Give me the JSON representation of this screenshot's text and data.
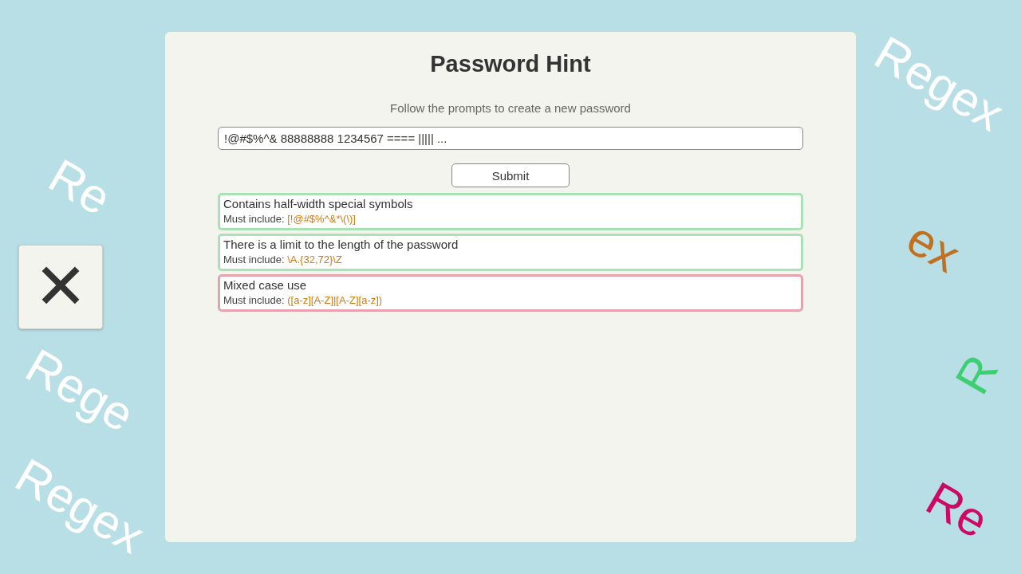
{
  "background_words": [
    {
      "text": "Regex",
      "color": "#ffffff"
    },
    {
      "text": "Re",
      "color": "#ffffff"
    },
    {
      "text": "Rege",
      "color": "#ffffff"
    },
    {
      "text": "Regex",
      "color": "#ffffff"
    },
    {
      "text": "R",
      "color": "#3ecf72"
    },
    {
      "text": "Re",
      "color": "#cc0a66"
    },
    {
      "text": "ex",
      "color": "#c0701e"
    }
  ],
  "close_button": {
    "label": "✕"
  },
  "panel": {
    "title": "Password Hint",
    "subtitle": "Follow the prompts to create a new password",
    "password_field": {
      "value": "!@#$%^& 88888888 1234567 ==== ||||| ..."
    },
    "submit_button": {
      "label": "Submit"
    },
    "rules": [
      {
        "title": "Contains half-width special symbols",
        "prefix": "Must include:",
        "pattern": "[!@#$%^&*\\(\\)]",
        "passed": true
      },
      {
        "title": "There is a limit to the length of the password",
        "prefix": "Must include:",
        "pattern": "\\A.{32,72}\\Z",
        "passed": true
      },
      {
        "title": "Mixed case use",
        "prefix": "Must include:",
        "pattern": "([a-z][A-Z]|[A-Z][a-z])",
        "passed": false
      }
    ]
  }
}
